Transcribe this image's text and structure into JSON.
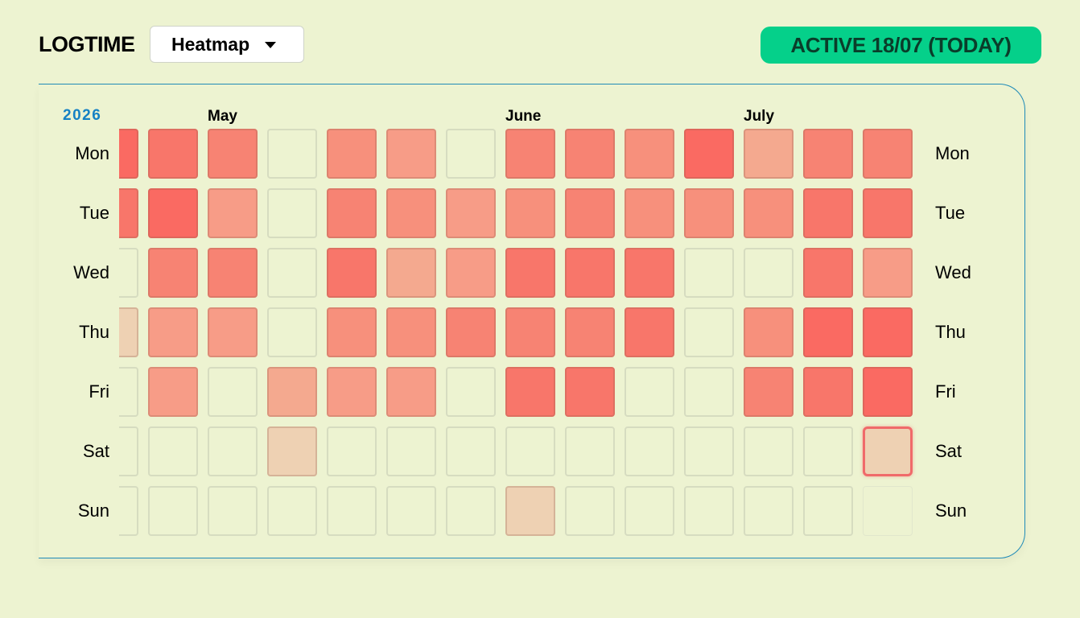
{
  "header": {
    "title": "LOGTIME",
    "view_select": "Heatmap",
    "status_badge": "ACTIVE 18/07 (TODAY)"
  },
  "calendar": {
    "year": "2026",
    "months": [
      {
        "label": "May",
        "week": 2
      },
      {
        "label": "June",
        "week": 7
      },
      {
        "label": "July",
        "week": 11
      }
    ],
    "days": [
      "Mon",
      "Tue",
      "Wed",
      "Thu",
      "Fri",
      "Sat",
      "Sun"
    ],
    "today": {
      "week": 13,
      "day": 5
    },
    "colors": {
      "empty": "transparent",
      "level_1": "#eed1b3",
      "level_2": "#f4a98f",
      "level_3": "#f79c87",
      "level_4": "#f7907c",
      "level_5": "#f78373",
      "level_6": "#f8766a",
      "level_7": "#fa6a62",
      "accent": "#05d08a",
      "year": "#1681c4"
    },
    "weeks": [
      [
        7,
        6,
        0,
        1,
        0,
        0,
        0
      ],
      [
        6,
        7,
        5,
        3,
        3,
        0,
        0
      ],
      [
        5,
        3,
        5,
        3,
        0,
        0,
        0
      ],
      [
        0,
        0,
        0,
        0,
        2,
        1,
        0
      ],
      [
        4,
        5,
        6,
        4,
        3,
        0,
        0
      ],
      [
        3,
        4,
        2,
        4,
        3,
        0,
        0
      ],
      [
        0,
        3,
        3,
        5,
        0,
        0,
        0
      ],
      [
        5,
        4,
        6,
        5,
        6,
        0,
        1
      ],
      [
        5,
        5,
        6,
        5,
        6,
        0,
        0
      ],
      [
        4,
        4,
        6,
        6,
        0,
        0,
        0
      ],
      [
        7,
        4,
        0,
        0,
        0,
        0,
        0
      ],
      [
        2,
        4,
        0,
        4,
        5,
        0,
        0
      ],
      [
        5,
        6,
        6,
        7,
        6,
        0,
        0
      ],
      [
        5,
        6,
        3,
        7,
        7,
        1,
        -1
      ]
    ]
  }
}
